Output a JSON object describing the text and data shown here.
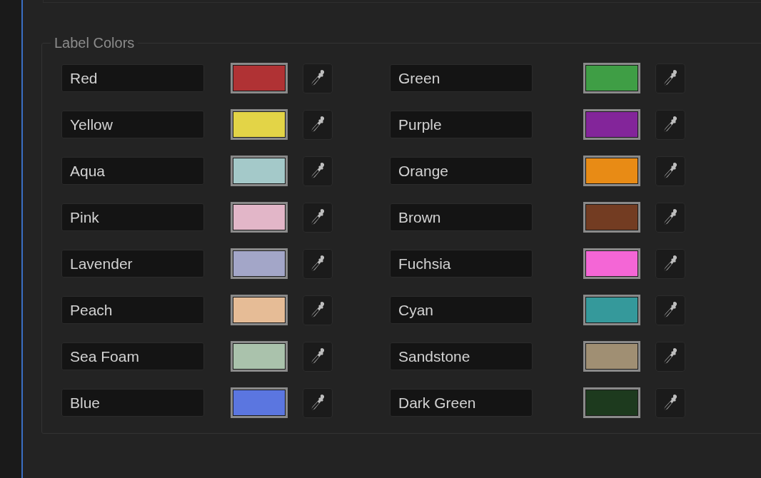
{
  "label_colors": {
    "title": "Label Colors",
    "items": [
      {
        "name": "Red",
        "color": "#b03234"
      },
      {
        "name": "Green",
        "color": "#3f9e45"
      },
      {
        "name": "Yellow",
        "color": "#e3d447"
      },
      {
        "name": "Purple",
        "color": "#83259a"
      },
      {
        "name": "Aqua",
        "color": "#a4c9c9"
      },
      {
        "name": "Orange",
        "color": "#e88b15"
      },
      {
        "name": "Pink",
        "color": "#e2b6c8"
      },
      {
        "name": "Brown",
        "color": "#733c22"
      },
      {
        "name": "Lavender",
        "color": "#a3a6c8"
      },
      {
        "name": "Fuchsia",
        "color": "#f466d6"
      },
      {
        "name": "Peach",
        "color": "#e6bc96"
      },
      {
        "name": "Cyan",
        "color": "#35999b"
      },
      {
        "name": "Sea Foam",
        "color": "#aac2ac"
      },
      {
        "name": "Sandstone",
        "color": "#a08f73"
      },
      {
        "name": "Blue",
        "color": "#5b76e0"
      },
      {
        "name": "Dark Green",
        "color": "#1d3a1e"
      }
    ]
  }
}
